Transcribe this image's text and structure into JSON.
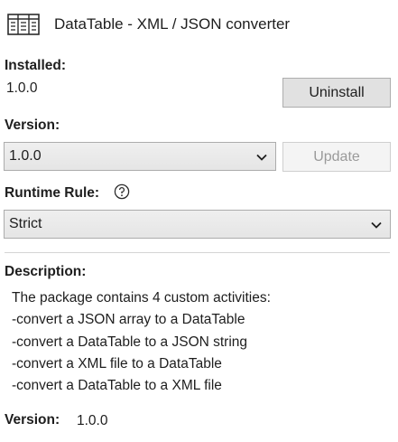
{
  "header": {
    "title": "DataTable - XML / JSON converter",
    "icon": "table-icon"
  },
  "installed": {
    "label": "Installed:",
    "value": "1.0.0",
    "uninstall_label": "Uninstall"
  },
  "version": {
    "label": "Version:",
    "selected": "1.0.0",
    "update_label": "Update",
    "update_enabled": false
  },
  "runtime_rule": {
    "label": "Runtime Rule:",
    "selected": "Strict",
    "help_icon": "help-icon"
  },
  "description": {
    "label": "Description:",
    "lines": [
      "The package contains 4 custom activities:",
      "-convert a JSON array to a DataTable",
      "-convert a DataTable to a JSON string",
      "-convert a XML file to a DataTable",
      "-convert a DataTable to a XML file"
    ]
  },
  "footer_version": {
    "label": "Version:",
    "value": "1.0.0"
  },
  "colors": {
    "button_bg": "#e1e1e1",
    "button_border": "#adadad",
    "disabled_text": "#9a9a9a",
    "divider": "#d4d4d4"
  }
}
